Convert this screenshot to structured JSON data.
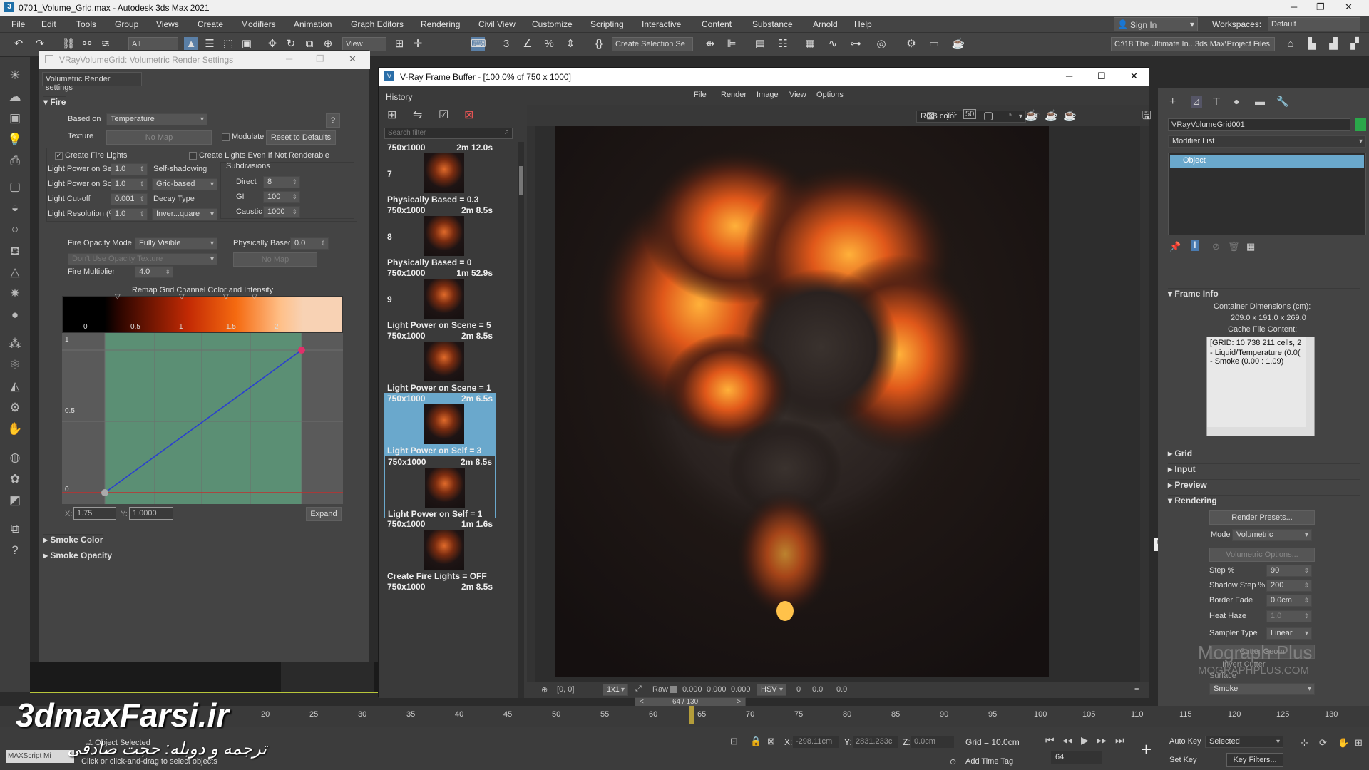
{
  "app": {
    "title": "0701_Volume_Grid.max - Autodesk 3ds Max 2021",
    "menu": [
      "File",
      "Edit",
      "Tools",
      "Group",
      "Views",
      "Create",
      "Modifiers",
      "Animation",
      "Graph Editors",
      "Rendering",
      "Civil View",
      "Customize",
      "Scripting",
      "Interactive",
      "Content",
      "Substance",
      "Arnold",
      "Help"
    ],
    "sign_in": "Sign In",
    "workspaces_label": "Workspaces:",
    "workspace_value": "Default",
    "project_path": "C:\\18 The Ultimate In...3ds Max\\Project Files",
    "selection_filter": "All",
    "view_dropdown": "View",
    "create_selection_set": "Create Selection Se"
  },
  "volumetric": {
    "window_title": "VRayVolumeGrid: Volumetric Render Settings",
    "tab": "Volumetric Render settings",
    "fire_section": "Fire",
    "based_on_label": "Based on",
    "based_on_value": "Temperature",
    "help": "?",
    "texture_label": "Texture",
    "texture_value": "No Map",
    "modulate": "Modulate",
    "reset_defaults": "Reset to Defaults",
    "create_fire_lights": "Create Fire Lights",
    "create_lights_even": "Create Lights Even If Not Renderable",
    "light_power_self_label": "Light Power on Self",
    "light_power_self_value": "1.0",
    "light_power_scene_label": "Light Power on Scene",
    "light_power_scene_value": "1.0",
    "light_cutoff_label": "Light Cut-off",
    "light_cutoff_value": "0.001",
    "light_resolution_label": "Light Resolution (%)",
    "light_resolution_value": "1.0",
    "self_shadowing_label": "Self-shadowing",
    "self_shadowing_value": "Grid-based",
    "decay_type_label": "Decay Type",
    "decay_type_value": "Inver...quare",
    "subdivisions_label": "Subdivisions",
    "direct_label": "Direct",
    "direct_value": "8",
    "gi_label": "GI",
    "gi_value": "100",
    "caustic_label": "Caustic",
    "caustic_value": "1000",
    "fire_opacity_mode_label": "Fire Opacity Mode",
    "fire_opacity_mode_value": "Fully Visible",
    "physically_based_label": "Physically Based",
    "physically_based_value": "0.0",
    "dont_use_opacity": "Don't Use Opacity Texture",
    "no_map_2": "No Map",
    "fire_multiplier_label": "Fire Multiplier",
    "fire_multiplier_value": "4.0",
    "remap_label": "Remap Grid Channel Color and Intensity",
    "ramp_ticks": [
      "0",
      "0.5",
      "1",
      "1.5",
      "2"
    ],
    "curve_y_ticks": [
      "1",
      "0.5",
      "0"
    ],
    "x_label": "X:",
    "x_value": "1.75",
    "y_label": "Y:",
    "y_value": "1.0000",
    "expand": "Expand",
    "smoke_color": "Smoke Color",
    "smoke_opacity": "Smoke Opacity",
    "ramp_colors": [
      "#000000",
      "#2a0500",
      "#c32a04",
      "#f56a10",
      "#ffc089",
      "#f8d2b4"
    ]
  },
  "vfb": {
    "window_title": "V-Ray Frame Buffer - [100.0% of 750 x 1000]",
    "history_label": "History",
    "search_placeholder": "Search filter",
    "menus": [
      "File",
      "Render",
      "Image",
      "View",
      "Options"
    ],
    "channel": "RGB color",
    "history": [
      {
        "res": "750x1000",
        "time": "2m 12.0s",
        "name": "7"
      },
      {
        "res": "750x1000",
        "time": "2m 8.5s",
        "name": "Physically Based = 0.3"
      },
      {
        "res": "750x1000",
        "time": "1m 52.9s",
        "name": "Physically Based = 0"
      },
      {
        "res": "750x1000",
        "time": "2m 8.5s",
        "name": "Light Power on Scene = 5"
      },
      {
        "res": "750x1000",
        "time": "2m 6.5s",
        "name": "Light Power on Scene = 1"
      },
      {
        "res": "750x1000",
        "time": "2m 8.5s",
        "name": "Light Power on Self = 3"
      },
      {
        "res": "750x1000",
        "time": "1m 1.6s",
        "name": "Light Power on Self = 1"
      },
      {
        "res": "750x1000",
        "time": "2m 8.5s",
        "name": "Create Fire Lights = OFF"
      }
    ],
    "history_numbers": [
      "8",
      "9"
    ],
    "coords": "[0, 0]",
    "zoom": "1x1",
    "raw_label": "Raw",
    "raw_values": [
      "0.000",
      "0.000",
      "0.000"
    ],
    "color_mode": "HSV",
    "hsv_values": [
      "0",
      "0.0",
      "0.0"
    ],
    "frame_counter": "64 / 130"
  },
  "command_panel": {
    "object_name": "VRayVolumeGrid001",
    "modifier_list": "Modifier List",
    "stack_item": "Object",
    "frame_info": "Frame Info",
    "container_dims_label": "Container Dimensions (cm):",
    "container_dims": "209.0 x 191.0 x 269.0",
    "cache_label": "Cache File Content:",
    "cache_lines": [
      "[GRID: 10 738 211 cells, 2",
      "- Liquid/Temperature (0.0(",
      "- Smoke (0.00 : 1.09)"
    ],
    "grid": "Grid",
    "input": "Input",
    "preview": "Preview",
    "rendering": "Rendering",
    "render_presets": "Render Presets...",
    "mode_label": "Mode",
    "mode_value": "Volumetric",
    "volumetric_options": "Volumetric Options...",
    "step_label": "Step %",
    "step_value": "90",
    "shadow_step_label": "Shadow Step %",
    "shadow_step_value": "200",
    "border_fade_label": "Border Fade",
    "border_fade_value": "0.0cm",
    "heat_haze_label": "Heat Haze",
    "heat_haze_value": "1.0",
    "sampler_type_label": "Sampler Type",
    "sampler_type_value": "Linear",
    "cutter_geom": "Cutter Geom",
    "invert_cutter": "Invert Cutter",
    "surface": "Surface",
    "smoke_value": "Smoke"
  },
  "timeline": {
    "ticks": [
      "20",
      "25",
      "30",
      "35",
      "40",
      "45",
      "50",
      "55",
      "60",
      "65",
      "70",
      "75",
      "80",
      "85",
      "90",
      "95",
      "100",
      "105",
      "110",
      "115",
      "120",
      "125",
      "130"
    ]
  },
  "status": {
    "object_selected": "1 Object Selected",
    "hint": "Click or click-and-drag to select objects",
    "maxscript": "MAXScript Mi",
    "x_label": "X:",
    "x_value": "-298.11cm",
    "y_label": "Y:",
    "y_value": "2831.233c",
    "z_label": "Z:",
    "z_value": "0.0cm",
    "grid": "Grid = 10.0cm",
    "add_time_tag": "Add Time Tag",
    "auto_key": "Auto Key",
    "selected": "Selected",
    "set_key": "Set Key",
    "key_filters": "Key Filters...",
    "frame": "64"
  },
  "watermarks": {
    "site": "3dmaxFarsi.ir",
    "persian_credit": "ترجمه و دوبله: حجت صادقی",
    "mograph": "Mograph Plus",
    "mograph_url": "MOGRAPHPLUS.COM"
  }
}
